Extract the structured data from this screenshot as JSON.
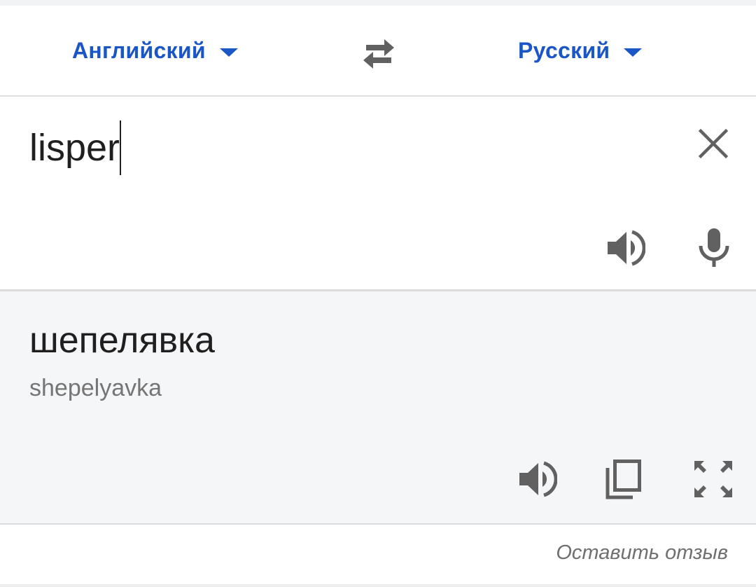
{
  "languages": {
    "source": "Английский",
    "target": "Русский"
  },
  "input": {
    "text": "lisper"
  },
  "output": {
    "translation": "шепелявка",
    "transliteration": "shepelyavka"
  },
  "footer": {
    "feedback_label": "Оставить отзыв"
  },
  "icons": {
    "swap": "swap-arrows-icon",
    "clear": "close-icon",
    "speak_source": "speaker-icon",
    "mic": "microphone-icon",
    "speak_target": "speaker-icon",
    "copy": "copy-icon",
    "fullscreen": "fullscreen-icon"
  },
  "colors": {
    "accent": "#1a56c6",
    "icon": "#616161",
    "output_bg": "#f5f6f8"
  }
}
